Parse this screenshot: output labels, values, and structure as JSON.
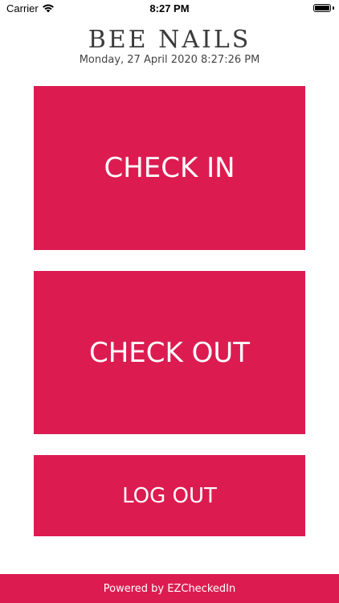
{
  "status_bar": {
    "carrier": "Carrier",
    "time": "8:27 PM",
    "icons": [
      "wifi-icon",
      "battery-icon"
    ]
  },
  "header": {
    "title": "BEE NAILS",
    "datetime": "Monday, 27 April 2020 8:27:26 PM"
  },
  "actions": {
    "check_in": "CHECK IN",
    "check_out": "CHECK OUT",
    "log_out": "LOG OUT"
  },
  "footer": {
    "text": "Powered by EZCheckedIn"
  },
  "colors": {
    "accent": "#dc1c50",
    "text_light": "#ffffff",
    "title": "#3b3b3b"
  }
}
